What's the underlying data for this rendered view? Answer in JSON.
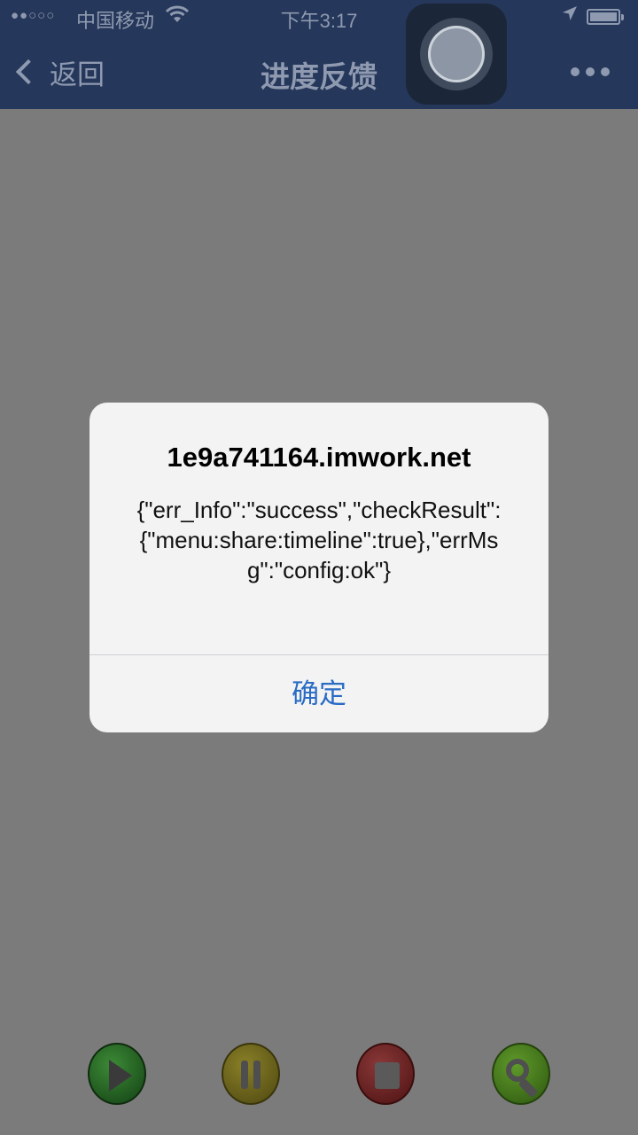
{
  "status_bar": {
    "signal": "●●○○○",
    "carrier": "中国移动",
    "wifi_icon": "wifi-icon",
    "time": "下午3:17",
    "location_icon": "location-arrow-icon",
    "battery_icon": "battery-icon"
  },
  "nav": {
    "back_label": "返回",
    "title": "进度反馈",
    "more_icon": "more-dots-icon"
  },
  "alert": {
    "title": "1e9a741164.imwork.net",
    "message": "{\"err_Info\":\"success\",\"checkResult\":{\"menu:share:timeline\":true},\"errMsg\":\"config:ok\"}",
    "confirm_label": "确定"
  },
  "toolbar": {
    "play_icon": "play-icon",
    "pause_icon": "pause-icon",
    "stop_icon": "stop-icon",
    "search_icon": "search-icon"
  },
  "colors": {
    "nav_bg": "#25375a",
    "overlay": "#7b7b7b",
    "alert_button": "#2a6cc4"
  }
}
